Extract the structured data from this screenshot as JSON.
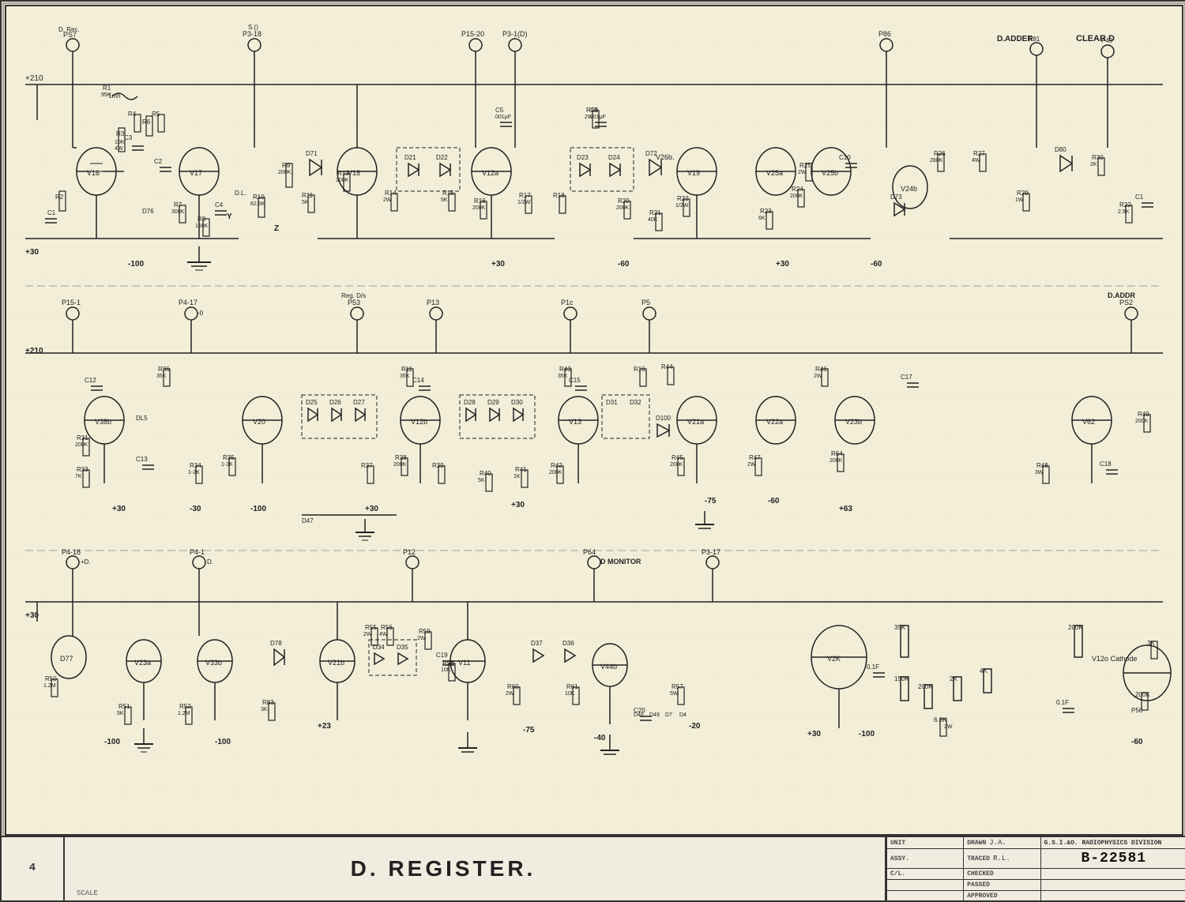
{
  "title": {
    "main": "D. REGISTER.",
    "drawing_number": "B-22581",
    "page": "4",
    "scale": "SCALE",
    "company": "G.S.I.&O.\nRADIOPHYSICS DIVISION",
    "unit_label": "UNIT",
    "assy_label": "ASSY.",
    "crl_label": "C/L.",
    "drawn_label": "DRAWN",
    "traced_label": "TRACED",
    "checked_label": "CHECKED",
    "passed_label": "PASSED",
    "approved_label": "APPROVED",
    "drawn_val": "J.A.",
    "traced_val": "R.L."
  },
  "labels": {
    "clear_d": "CLEAR D",
    "d_adder": "D.ADDER",
    "d_monitor": "D MONITOR",
    "d_adder_r": "D.ADDR",
    "plus_210": "+210",
    "ps7": "PS7",
    "d_rec": "D. Rec.",
    "reg_dis": "Reg. D/s"
  },
  "icons": {
    "connector_symbol": "⊙"
  }
}
